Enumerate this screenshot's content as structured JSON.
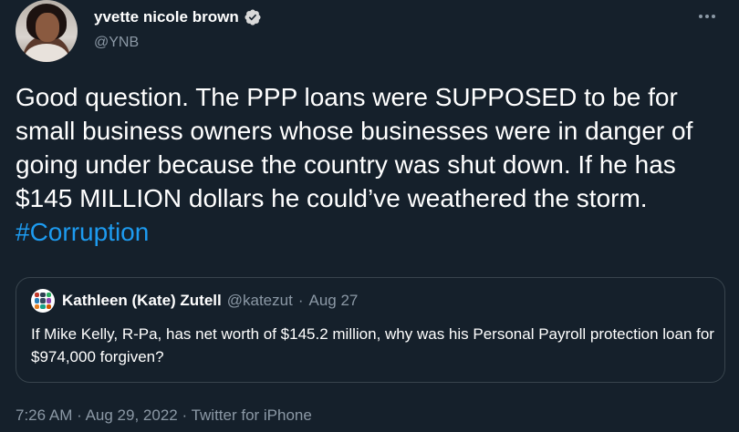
{
  "author": {
    "display_name": "yvette nicole brown",
    "handle": "@YNB",
    "verified": true
  },
  "tweet": {
    "text": "Good question. The PPP loans were SUPPOSED to be for small business owners whose businesses were in danger of going under because the country was shut down. If he has  $145 MILLION dollars he could’ve weathered the storm.",
    "hashtag": "#Corruption"
  },
  "quoted": {
    "display_name": "Kathleen (Kate) Zutell",
    "handle": "@katezut",
    "separator": "·",
    "date": "Aug 27",
    "text": "If Mike Kelly, R-Pa, has net worth of  $145.2 million, why was his Personal Payroll protection loan for $974,000 forgiven?"
  },
  "footer": {
    "time": "7:26 AM",
    "date": "Aug 29, 2022",
    "source": "Twitter for iPhone",
    "separator": "·"
  },
  "icons": {
    "more": "more-horizontal-icon",
    "verified": "verified-badge-icon"
  },
  "colors": {
    "background": "#15202b",
    "text": "#ffffff",
    "secondary": "#8b98a5",
    "link": "#1d9bf0",
    "border": "#38444d",
    "verified": "#d9d9d9"
  }
}
